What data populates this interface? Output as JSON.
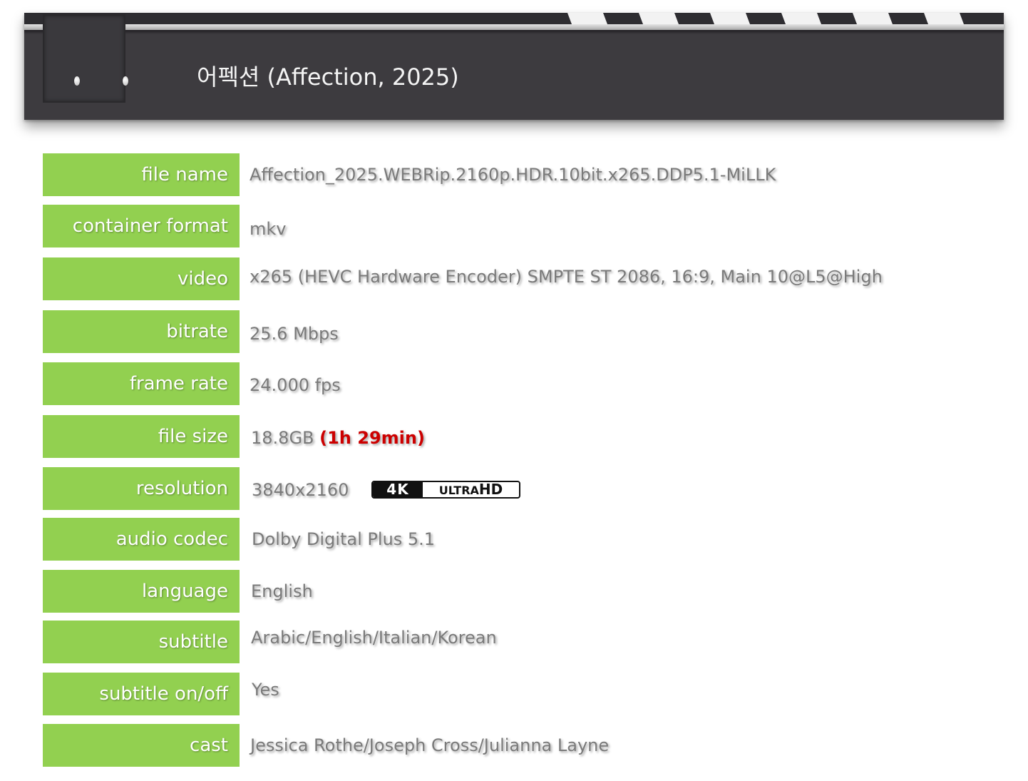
{
  "header": {
    "title": "어펙션 (Affection, 2025)"
  },
  "specs": {
    "file_name": {
      "label": "file name",
      "value": "Affection_2025.WEBRip.2160p.HDR.10bit.x265.DDP5.1-MiLLK"
    },
    "container_format": {
      "label": "container format",
      "value": "mkv"
    },
    "video": {
      "label": "video",
      "value": "x265 (HEVC Hardware Encoder) SMPTE ST 2086, 16:9, Main 10@L5@High"
    },
    "bitrate": {
      "label": "bitrate",
      "value": "25.6 Mbps"
    },
    "frame_rate": {
      "label": "frame rate",
      "value": "24.000 fps"
    },
    "file_size": {
      "label": "file size",
      "value": "18.8GB",
      "runtime": "(1h 29min)"
    },
    "resolution": {
      "label": "resolution",
      "value": "3840x2160",
      "badge_4k": "4K",
      "badge_ultra": "ULTRA",
      "badge_hd": "HD"
    },
    "audio_codec": {
      "label": "audio codec",
      "value": "Dolby Digital Plus 5.1"
    },
    "language": {
      "label": "language",
      "value": "English"
    },
    "subtitle": {
      "label": "subtitle",
      "value": "Arabic/English/Italian/Korean"
    },
    "subtitle_onoff": {
      "label": "subtitle on/off",
      "value": "Yes"
    },
    "cast": {
      "label": "cast",
      "value": "Jessica Rothe/Joseph Cross/Julianna Layne"
    }
  },
  "colors": {
    "label_bg": "#92d050",
    "value_text": "#7a7a7a",
    "runtime_text": "#cc0000",
    "clapper_bg": "#3d3b3f"
  },
  "icons": {
    "clapper": "clapperboard-icon",
    "resolution_badge": "4k-ultra-hd-logo"
  }
}
